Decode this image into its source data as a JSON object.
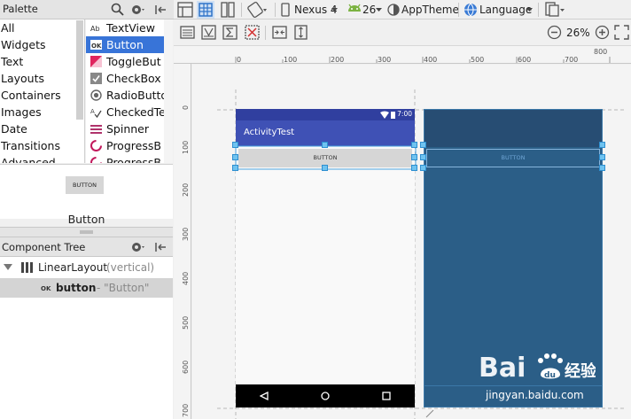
{
  "palette": {
    "title": "Palette",
    "categories": [
      "All",
      "Widgets",
      "Text",
      "Layouts",
      "Containers",
      "Images",
      "Date",
      "Transitions",
      "Advanced"
    ],
    "widgets": [
      {
        "icon": "ab-text-icon",
        "label": "TextView"
      },
      {
        "icon": "ok-button-icon",
        "label": "Button",
        "selected": true
      },
      {
        "icon": "toggle-button-icon",
        "label": "ToggleBut"
      },
      {
        "icon": "checkbox-icon",
        "label": "CheckBox"
      },
      {
        "icon": "radio-button-icon",
        "label": "RadioButto"
      },
      {
        "icon": "checked-text-icon",
        "label": "CheckedTe"
      },
      {
        "icon": "spinner-icon",
        "label": "Spinner"
      },
      {
        "icon": "progress-circle-icon",
        "label": "ProgressB"
      },
      {
        "icon": "progress-circle-icon",
        "label": "ProgressB"
      }
    ],
    "preview_button_label": "BUTTON",
    "preview_name": "Button"
  },
  "component_tree": {
    "title": "Component Tree",
    "root_label": "LinearLayout",
    "root_detail": "(vertical)",
    "child_label": "button",
    "child_detail": "- \"Button\""
  },
  "toolbar": {
    "device": "Nexus 4",
    "api": "26",
    "theme": "AppTheme",
    "language": "Language",
    "zoom": "26%"
  },
  "rulers": {
    "horizontal": [
      "0",
      "100",
      "200",
      "300",
      "400",
      "500",
      "600",
      "700",
      "800"
    ],
    "vertical": [
      "0",
      "100",
      "200",
      "300",
      "400",
      "500",
      "600",
      "700"
    ]
  },
  "device_preview": {
    "status_time": "7:00",
    "app_title": "ActivityTest",
    "button_label": "BUTTON"
  },
  "blueprint": {
    "button_label": "BUTTON"
  },
  "watermark": {
    "logo_text": "Bai 经验",
    "url": "jingyan.baidu.com"
  },
  "colors": {
    "accent": "#3874d8",
    "app_bar": "#3f51b5",
    "status_bar": "#303f9f",
    "blueprint": "#2b5e87"
  }
}
